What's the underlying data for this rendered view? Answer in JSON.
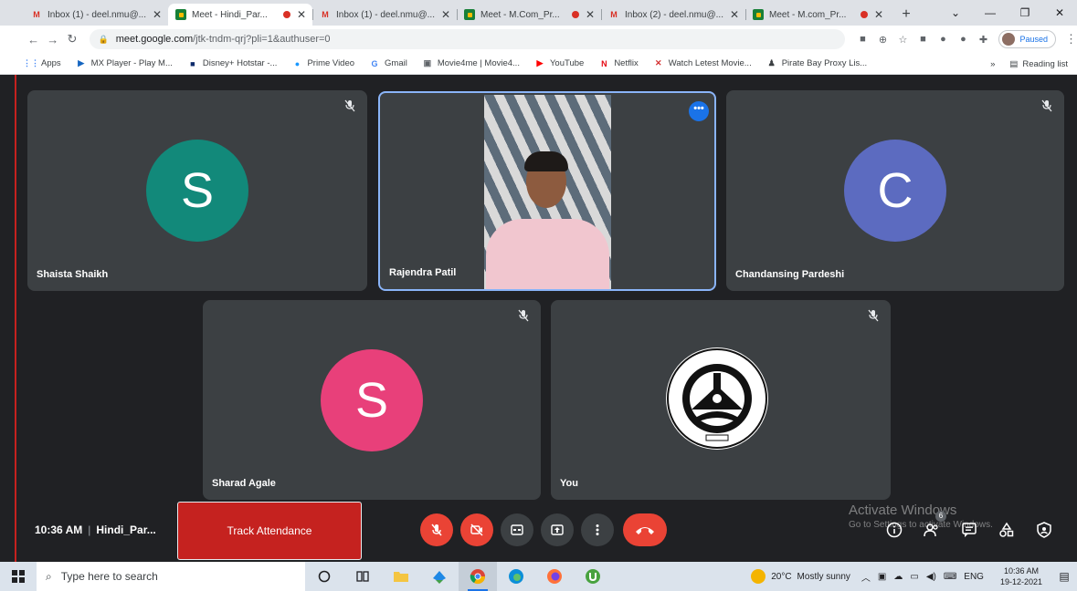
{
  "browser": {
    "tabs": [
      {
        "icon": "gmail-icon",
        "title": "Inbox (1) - deel.nmu@...",
        "recording": false,
        "active": false
      },
      {
        "icon": "meet-icon",
        "title": "Meet - Hindi_Par...",
        "recording": true,
        "active": true
      },
      {
        "icon": "gmail-icon",
        "title": "Inbox (1) - deel.nmu@...",
        "recording": false,
        "active": false
      },
      {
        "icon": "meet-icon",
        "title": "Meet - M.Com_Pr...",
        "recording": true,
        "active": false
      },
      {
        "icon": "gmail-icon",
        "title": "Inbox (2) - deel.nmu@...",
        "recording": false,
        "active": false
      },
      {
        "icon": "meet-icon",
        "title": "Meet - M.com_Pr...",
        "recording": true,
        "active": false
      }
    ],
    "url_host": "meet.google.com",
    "url_path": "/jtk-tndm-qrj?pli=1&authuser=0",
    "profile_label": "Paused",
    "bookmarks": [
      {
        "icon": "apps-icon",
        "label": "Apps",
        "color": "#4285f4"
      },
      {
        "icon": "mx-player-icon",
        "label": "MX Player - Play M...",
        "color": "#1565c0"
      },
      {
        "icon": "hotstar-icon",
        "label": "Disney+ Hotstar -...",
        "color": "#0d2b6b"
      },
      {
        "icon": "prime-video-icon",
        "label": "Prime Video",
        "color": "#1a98ff"
      },
      {
        "icon": "google-icon",
        "label": "Gmail",
        "color": "#4285f4"
      },
      {
        "icon": "movie-icon",
        "label": "Movie4me | Movie4...",
        "color": "#5f6368"
      },
      {
        "icon": "youtube-icon",
        "label": "YouTube",
        "color": "#ff0000"
      },
      {
        "icon": "netflix-icon",
        "label": "Netflix",
        "color": "#e50914"
      },
      {
        "icon": "x-icon",
        "label": "Watch Letest Movie...",
        "color": "#d32f2f"
      },
      {
        "icon": "pirate-icon",
        "label": "Pirate Bay Proxy Lis...",
        "color": "#3c4043"
      }
    ],
    "reading_list": "Reading list"
  },
  "meet": {
    "participants": [
      {
        "name": "Shaista Shaikh",
        "initial": "S",
        "avatar_color": "#12897a",
        "muted": true
      },
      {
        "name": "Rajendra Patil",
        "initial": "",
        "video": true,
        "active_speaker": true
      },
      {
        "name": "Chandansing Pardeshi",
        "initial": "C",
        "avatar_color": "#5c6bc0",
        "muted": true
      },
      {
        "name": "Sharad Agale",
        "initial": "S",
        "avatar_color": "#e8407a",
        "muted": true
      },
      {
        "name": "You",
        "initial": "",
        "logo": "university-logo",
        "muted": true
      }
    ],
    "time": "10:36 AM",
    "meeting_name": "Hindi_Par...",
    "track_attendance": "Track Attendance",
    "controls": [
      "mic-off-icon",
      "camera-off-icon",
      "captions-icon",
      "present-icon",
      "more-options-icon",
      "end-call-icon"
    ],
    "right_controls": [
      "info-icon",
      "people-icon",
      "chat-icon",
      "activities-icon",
      "host-controls-icon"
    ],
    "participant_count": "6"
  },
  "windows": {
    "watermark_title": "Activate Windows",
    "watermark_sub": "Go to Settings to activate Windows.",
    "search_placeholder": "Type here to search",
    "weather_temp": "20°C",
    "weather_text": "Mostly sunny",
    "language": "ENG",
    "time": "10:36 AM",
    "date": "19-12-2021"
  }
}
